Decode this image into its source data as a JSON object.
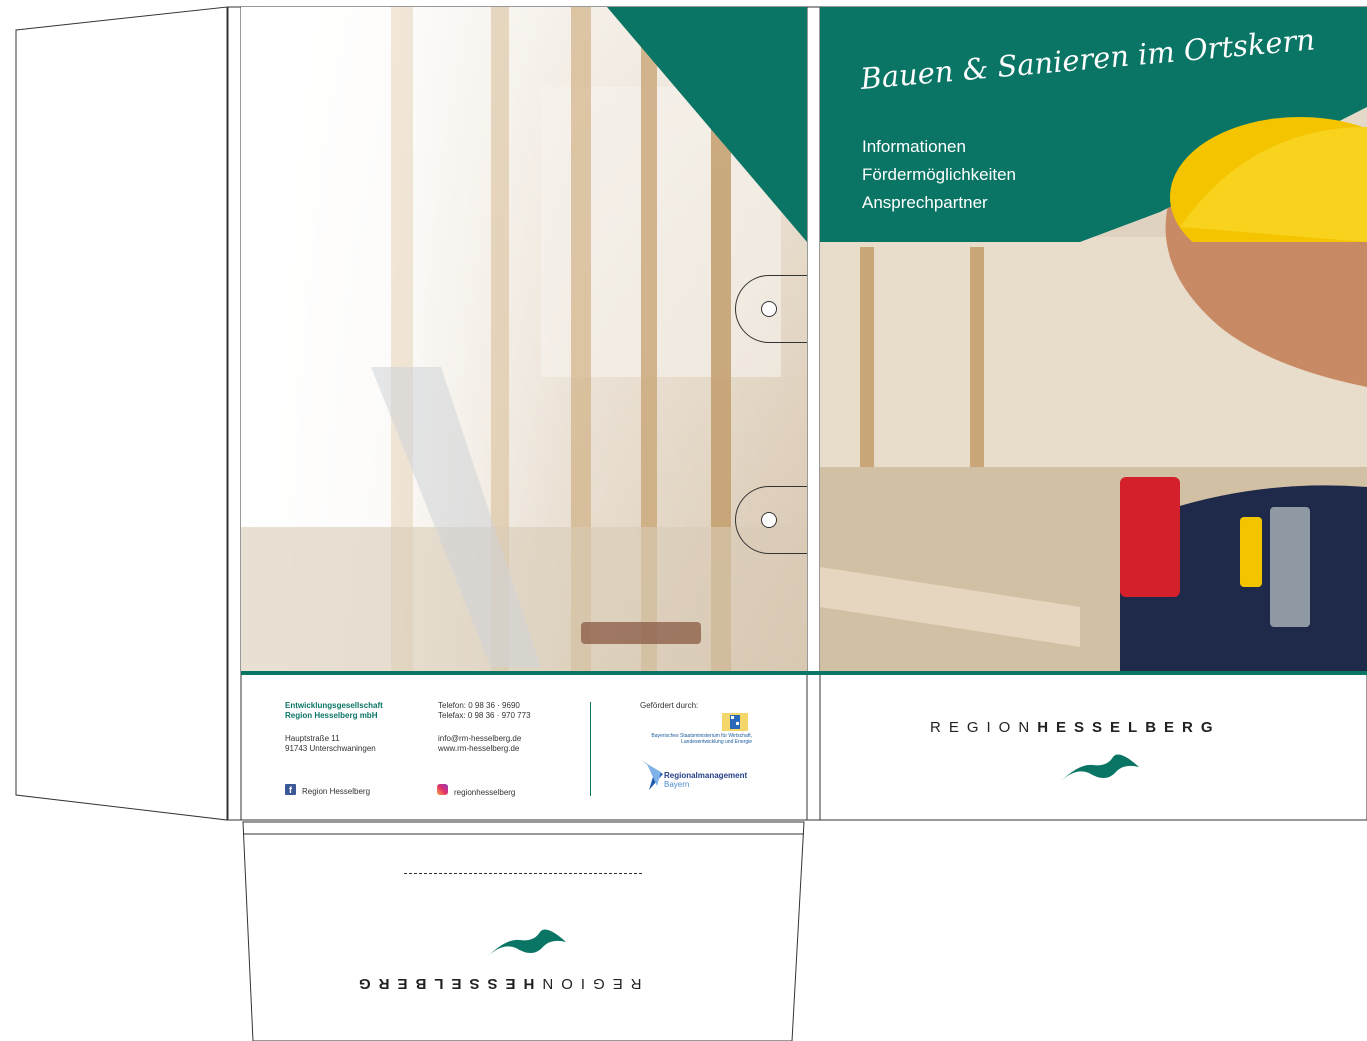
{
  "cover": {
    "title": "Bauen & Sanieren im Ortskern",
    "items": [
      "Informationen",
      "Fördermöglichkeiten",
      "Ansprechpartner"
    ]
  },
  "contact": {
    "company_line1": "Entwicklungsgesellschaft",
    "company_line2": "Region Hesselberg mbH",
    "street": "Hauptstraße 11",
    "city": "91743 Unterschwaningen",
    "phone": "Telefon: 0 98 36 · 9690",
    "fax": "Telefax: 0 98 36 · 970 773",
    "email": "info@rm-hesselberg.de",
    "web": "www.rm-hesselberg.de",
    "facebook": "Region Hesselberg",
    "instagram": "regionhesselberg"
  },
  "sponsor": {
    "heading": "Gefördert durch:",
    "ministry": "Bayerisches Staatsministerium für Wirtschaft, Landesentwicklung und Energie",
    "rm_name": "Regionalmanagement",
    "rm_region": "Bayern"
  },
  "brand": {
    "light": "REGION",
    "bold": "HESSELBERG"
  },
  "colors": {
    "accent_green": "#0a7565",
    "helmet_yellow": "#f5c400"
  }
}
